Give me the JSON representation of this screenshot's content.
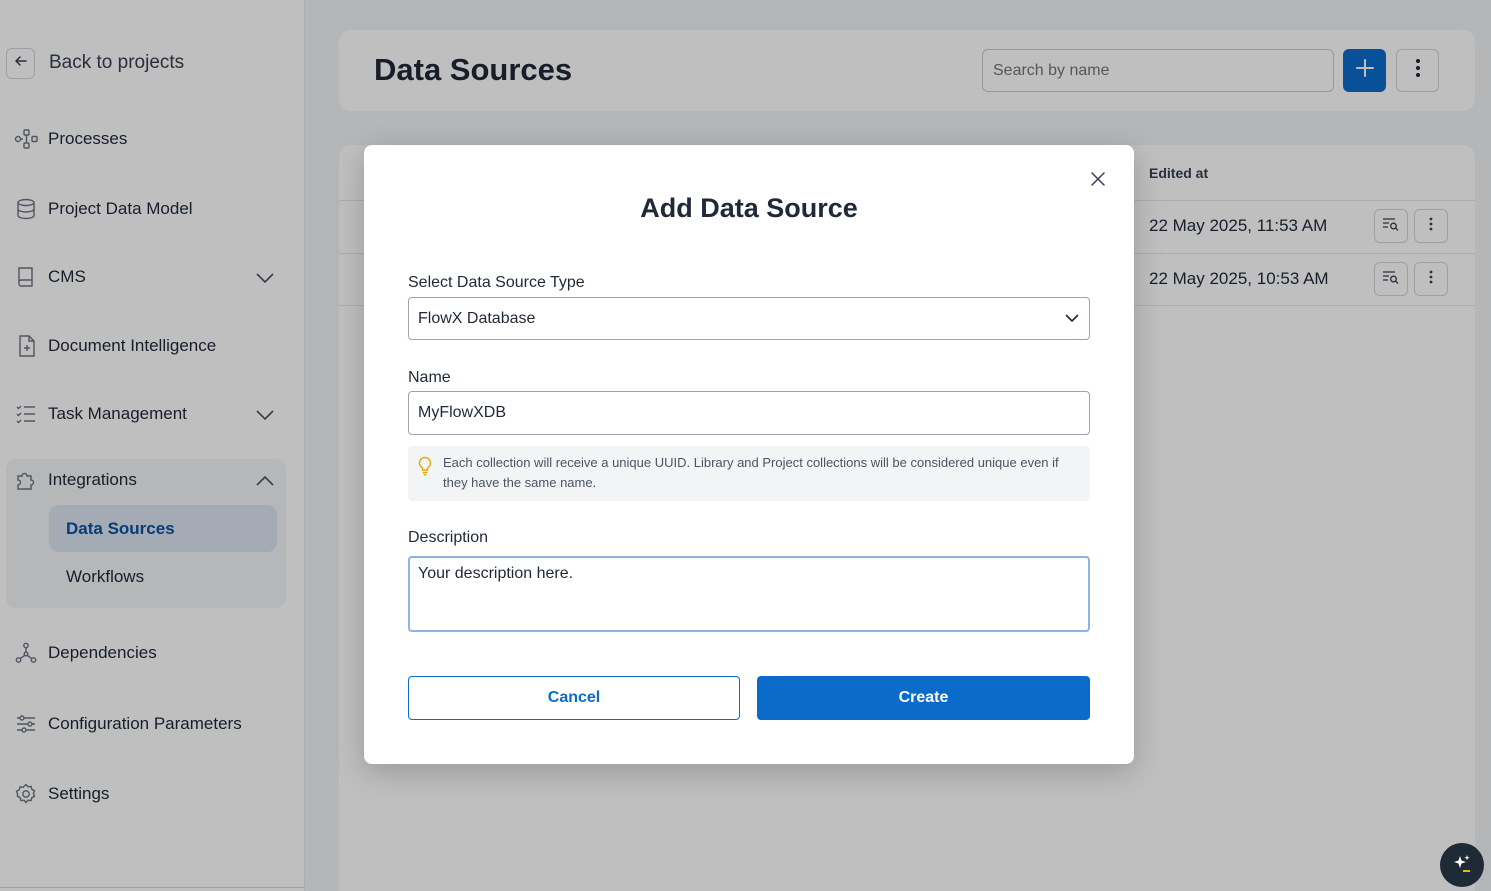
{
  "sidebar": {
    "back_label": "Back to projects",
    "items": [
      {
        "label": "Processes"
      },
      {
        "label": "Project Data Model"
      },
      {
        "label": "CMS"
      },
      {
        "label": "Document Intelligence"
      },
      {
        "label": "Task Management"
      },
      {
        "label": "Integrations"
      },
      {
        "label": "Dependencies"
      },
      {
        "label": "Configuration Parameters"
      },
      {
        "label": "Settings"
      }
    ],
    "integrations_sub": [
      {
        "label": "Data Sources",
        "active": true
      },
      {
        "label": "Workflows",
        "active": false
      }
    ]
  },
  "header": {
    "title": "Data Sources",
    "search_placeholder": "Search by name"
  },
  "table": {
    "column_header": "Edited at",
    "rows": [
      {
        "edited_at": "22 May 2025, 11:53 AM"
      },
      {
        "edited_at": "22 May 2025, 10:53 AM"
      }
    ]
  },
  "modal": {
    "title": "Add Data Source",
    "type_label": "Select Data Source Type",
    "type_value": "FlowX Database",
    "name_label": "Name",
    "name_value": "MyFlowXDB",
    "info_text": "Each collection will receive a unique UUID. Library and Project collections will be considered unique even if they have the same name.",
    "description_label": "Description",
    "description_value": "Your description here.",
    "cancel_label": "Cancel",
    "create_label": "Create"
  },
  "colors": {
    "primary": "#0b6bcb",
    "active_bg": "#dbe4f0",
    "info_icon": "#e0a800"
  }
}
